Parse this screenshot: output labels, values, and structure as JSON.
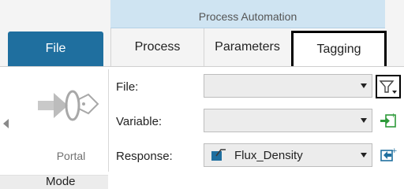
{
  "ribbon": {
    "context_title": "Process Automation",
    "tabs": {
      "file": "File",
      "process": "Process",
      "parameters": "Parameters",
      "tagging": "Tagging"
    }
  },
  "mode_group": {
    "button_label": "Portal",
    "group_label": "Mode"
  },
  "fields": {
    "file_label": "File:",
    "file_value": "",
    "variable_label": "Variable:",
    "variable_value": "",
    "response_label": "Response:",
    "response_value": "Flux_Density"
  },
  "colors": {
    "file_tab": "#1f6f9f",
    "context_header": "#cfe4f2",
    "add_variable_icon": "#2e9a3a",
    "add_response_icon": "#1f6f9f"
  }
}
